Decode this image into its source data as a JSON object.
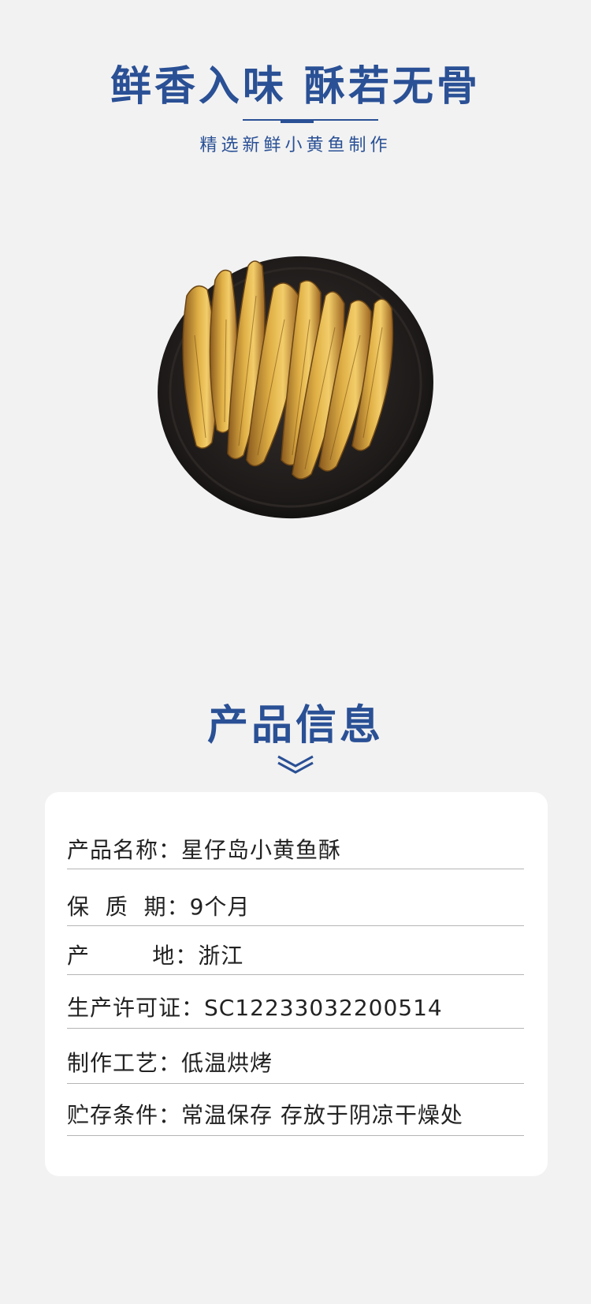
{
  "hero": {
    "title": "鲜香入味 酥若无骨",
    "subtitle": "精选新鲜小黄鱼制作"
  },
  "section": {
    "title": "产品信息"
  },
  "product_info": {
    "rows": [
      {
        "label": "产品名称：",
        "value": "星仔岛小黄鱼酥"
      },
      {
        "label": "保  质  期：",
        "value": "9个月"
      },
      {
        "label": "产        地：",
        "value": "浙江"
      },
      {
        "label": "生产许可证：",
        "value": "SC12233032200514"
      },
      {
        "label": "制作工艺：",
        "value": "低温烘烤"
      },
      {
        "label": "贮存条件：",
        "value": "常温保存 存放于阴凉干燥处"
      }
    ]
  },
  "colors": {
    "accent": "#2a5095",
    "background": "#f2f2f2",
    "card": "#ffffff"
  },
  "icons": {
    "chevron": "double-chevron-down-icon",
    "image": "dried-yellow-croaker-plate"
  }
}
